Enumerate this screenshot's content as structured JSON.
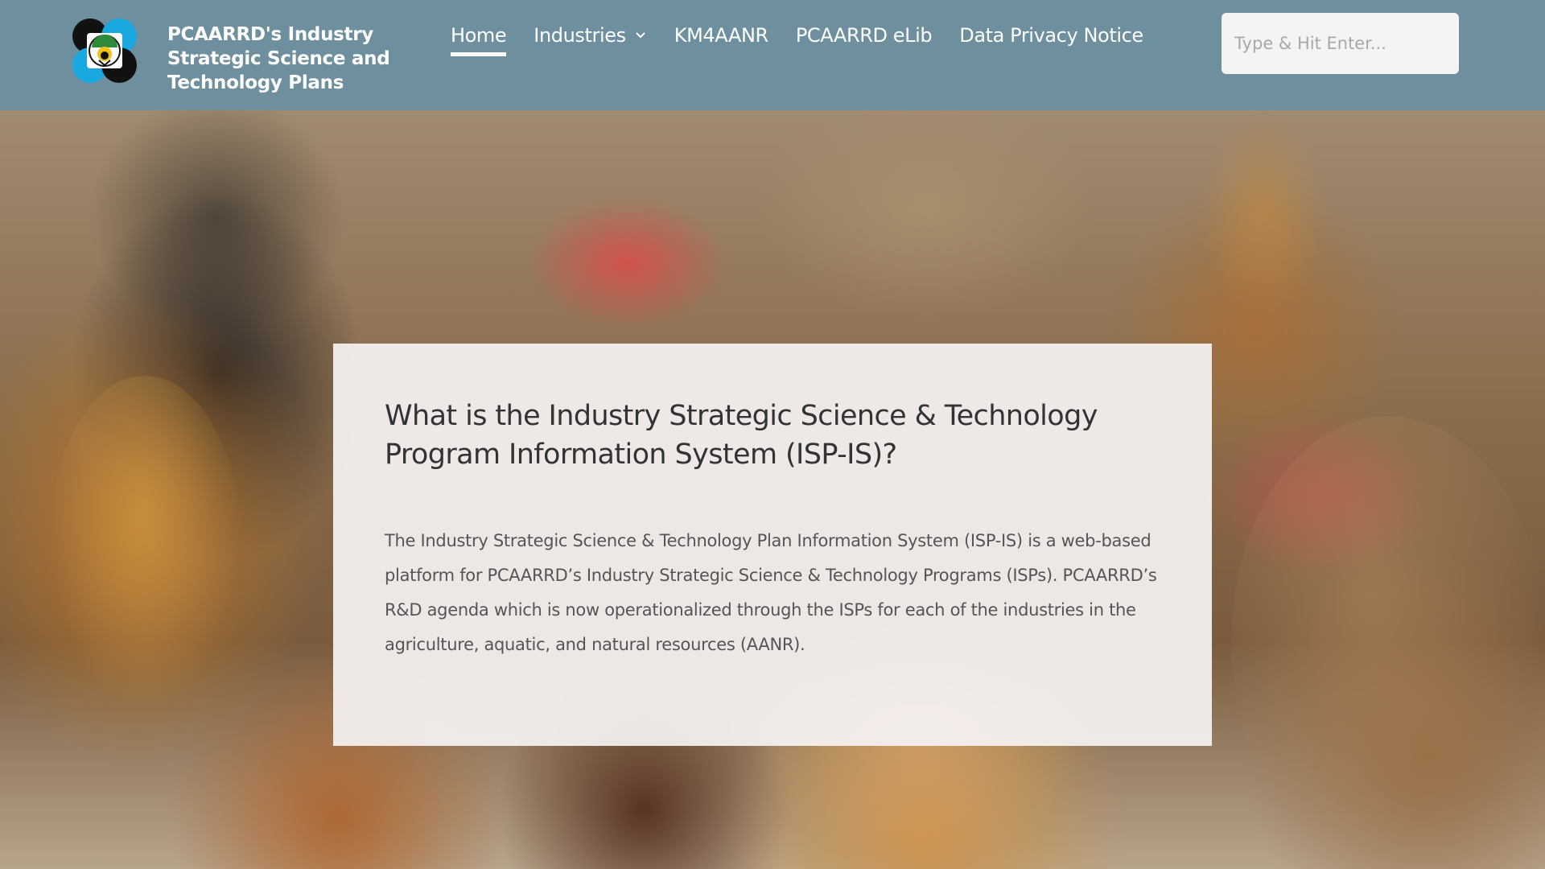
{
  "brand": {
    "line1": "PCAARRD's Industry",
    "line2": "Strategic Science and",
    "line3": "Technology Plans",
    "logo_icon": "pcaarrd-logo-icon",
    "colors": {
      "black": "#111111",
      "blue": "#1aa8e0",
      "green": "#2e8b3a",
      "yellow": "#f2c21b"
    }
  },
  "nav": {
    "items": [
      {
        "label": "Home",
        "active": true
      },
      {
        "label": "Industries",
        "has_dropdown": true,
        "icon": "chevron-down-icon"
      },
      {
        "label": "KM4AANR"
      },
      {
        "label": "PCAARRD eLib"
      },
      {
        "label": "Data Privacy Notice"
      }
    ]
  },
  "search": {
    "placeholder": "Type & Hit Enter...",
    "value": ""
  },
  "hero": {
    "image": "hero-chickens-image",
    "card": {
      "title": "What is the Industry Strategic Science & Technology Program Information System (ISP-IS)?",
      "body": "The Industry Strategic Science & Technology Plan Information System (ISP-IS) is a web-based platform for PCAARRD’s Industry Strategic Science & Technology Programs (ISPs). PCAARRD’s R&D agenda which is now operationalized through the ISPs for each of the industries in the agriculture, aquatic, and natural resources (AANR)."
    }
  },
  "theme": {
    "header_bg": "#6e8f9e",
    "header_text": "#ffffff",
    "card_bg": "#f5f2f2",
    "title_color": "#333333",
    "body_color": "#555555"
  }
}
